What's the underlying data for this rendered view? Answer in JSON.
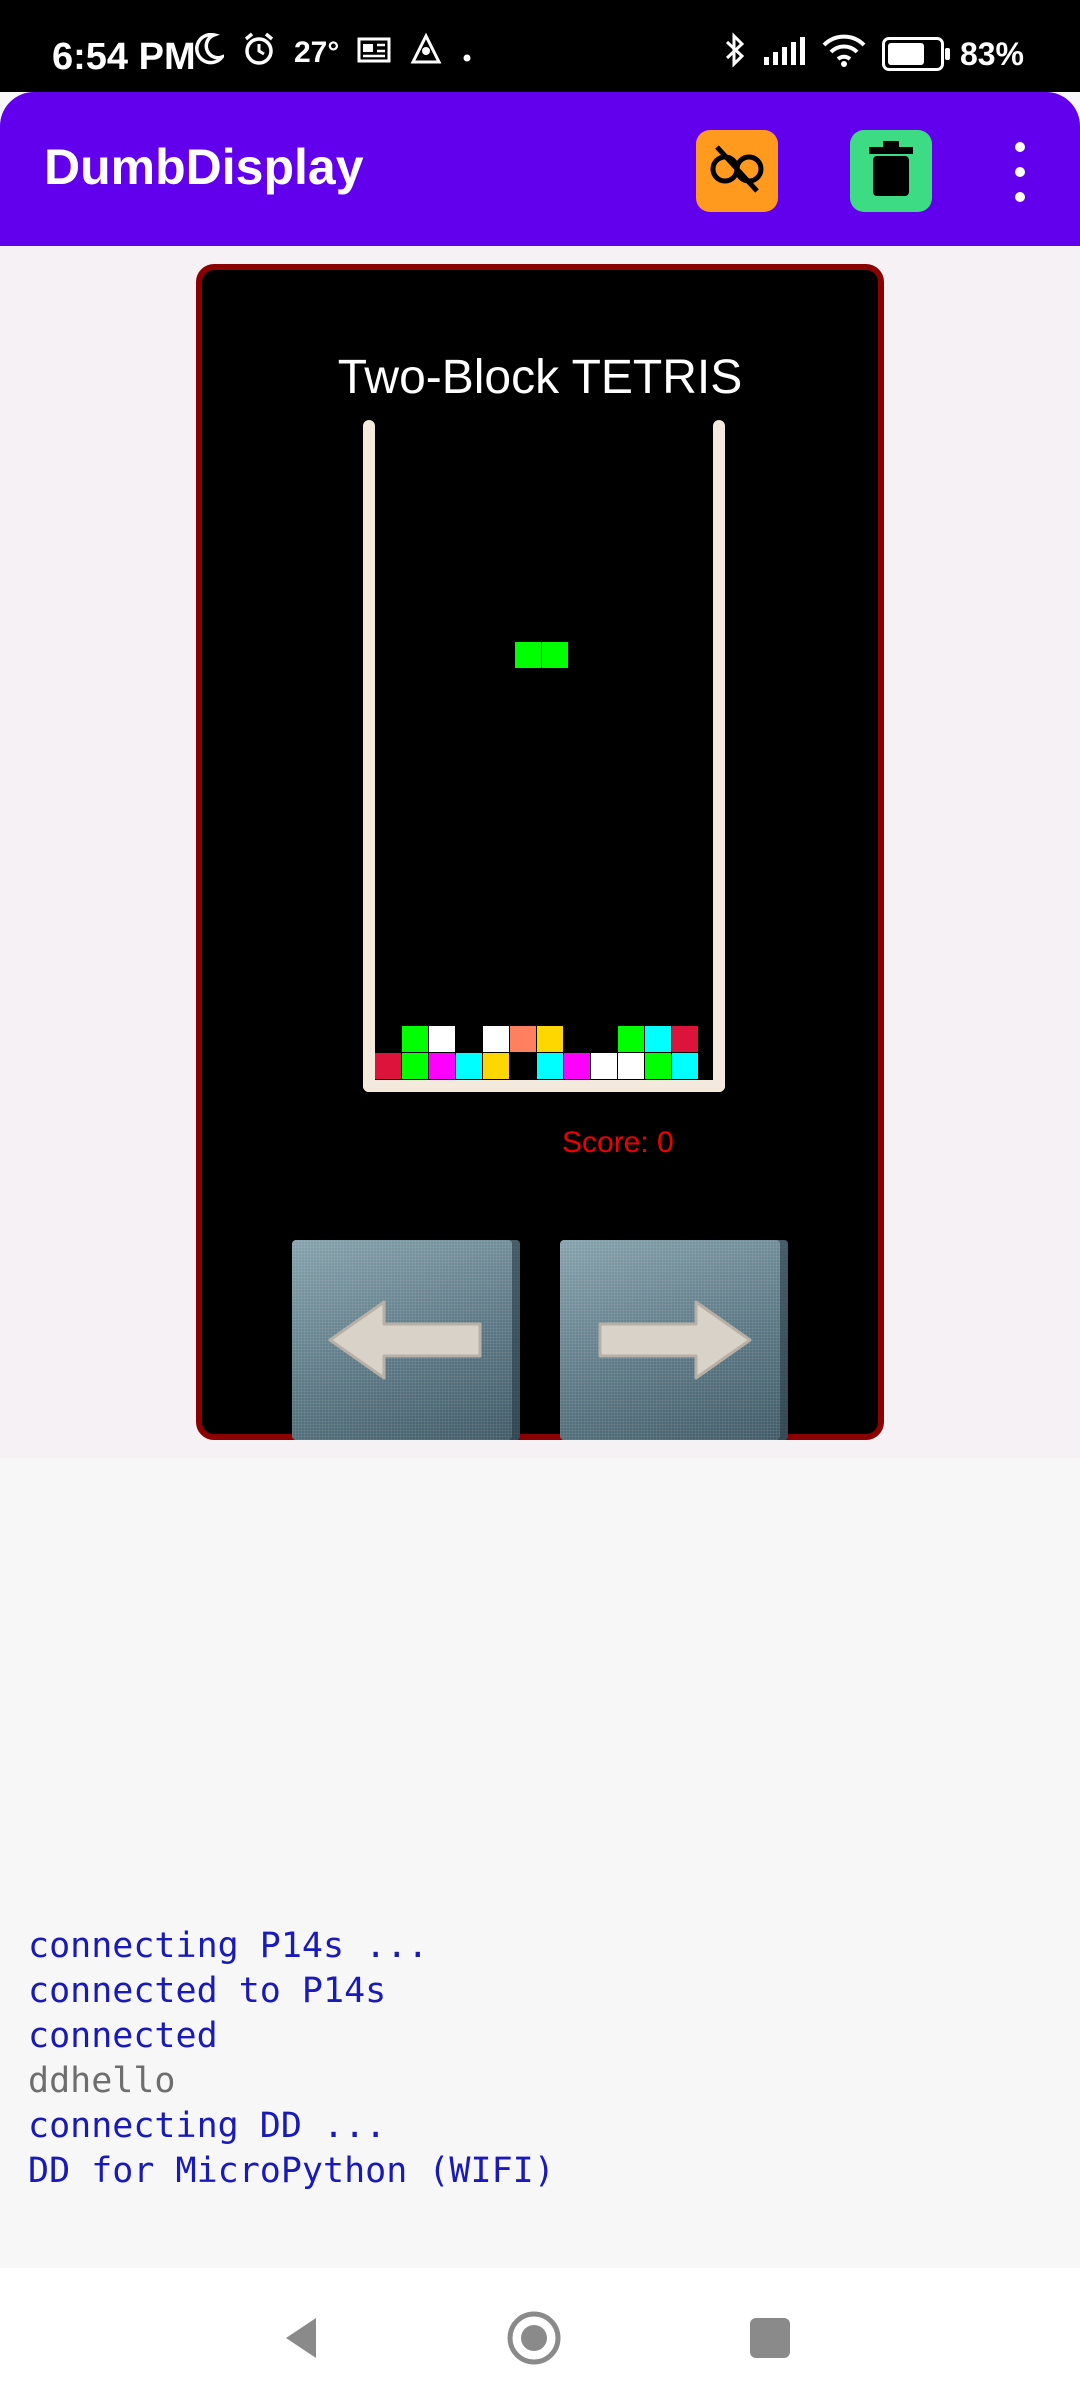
{
  "status_bar": {
    "time": "6:54 PM",
    "temperature": "27°",
    "battery_percent": "83%",
    "battery_level": 0.83,
    "icons": [
      "moon-icon",
      "alarm-icon",
      "news-icon",
      "app-notification-icon",
      "dot-icon",
      "bluetooth-icon",
      "signal-icon",
      "wifi-icon",
      "battery-icon"
    ]
  },
  "app_bar": {
    "title": "DumbDisplay",
    "buttons": [
      "unlink-icon",
      "delete-icon",
      "more-vert-icon"
    ],
    "colors": {
      "bar": "#6200ee",
      "unlink_bg": "#ff9a1f",
      "delete_bg": "#3ddc84"
    }
  },
  "game": {
    "title": "Two-Block TETRIS",
    "score_text": "Score: 0",
    "colors": {
      "border": "#8b0000",
      "score": "#ee0000"
    },
    "falling_piece": [
      "#00ff00",
      "#00ff00"
    ],
    "stack_rows": [
      [
        "",
        "#00ff00",
        "#ffffff",
        "",
        "#ffffff",
        "#ff8060",
        "#ffd700",
        "",
        "",
        "#00ff00",
        "#00ffff",
        "#dc143c"
      ],
      [
        "#dc143c",
        "#00ff00",
        "#ff00ff",
        "#00ffff",
        "#ffd700",
        "",
        "#00ffff",
        "#ff00ff",
        "#ffffff",
        "#ffffff",
        "#00ff00",
        "#00ffff"
      ]
    ],
    "controls": [
      "arrow-left-icon",
      "arrow-right-icon"
    ]
  },
  "log": {
    "lines": [
      {
        "text": "connecting P14s ...",
        "style": "blue"
      },
      {
        "text": "connected to P14s",
        "style": "blue"
      },
      {
        "text": "connected",
        "style": "blue"
      },
      {
        "text": "ddhello",
        "style": "gray"
      },
      {
        "text": "connecting DD ...",
        "style": "blue"
      },
      {
        "text": "DD for MicroPython (WIFI)",
        "style": "blue"
      }
    ]
  },
  "nav_bar": {
    "icons": [
      "back-icon",
      "home-icon",
      "recents-icon"
    ]
  }
}
